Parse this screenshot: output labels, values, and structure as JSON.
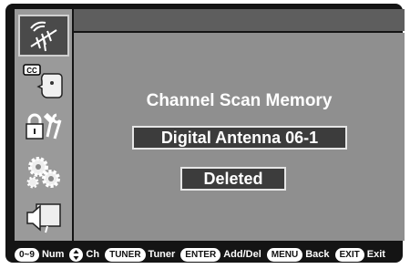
{
  "sidebar": {
    "items": [
      {
        "icon": "antenna-icon",
        "active": true
      },
      {
        "icon": "cc-caption-icon",
        "badge": "CC"
      },
      {
        "icon": "lock-tools-icon"
      },
      {
        "icon": "gears-icon"
      },
      {
        "icon": "speaker-screen-icon"
      }
    ]
  },
  "screen": {
    "title": "Channel Scan Memory",
    "channel": "Digital Antenna 06-1",
    "status": "Deleted"
  },
  "legend": [
    {
      "key": "0~9",
      "label": "Num"
    },
    {
      "key": "updown",
      "label": "Ch"
    },
    {
      "key": "TUNER",
      "label": "Tuner"
    },
    {
      "key": "ENTER",
      "label": "Add/Del"
    },
    {
      "key": "MENU",
      "label": "Back"
    },
    {
      "key": "EXIT",
      "label": "Exit"
    }
  ]
}
